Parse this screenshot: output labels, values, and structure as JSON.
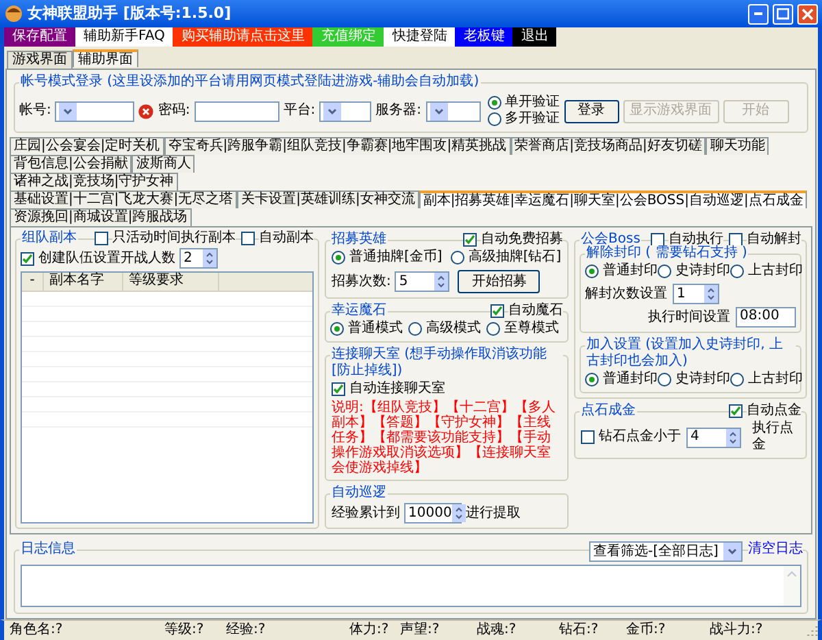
{
  "window": {
    "title": "女神联盟助手 [版本号:1.5.0]"
  },
  "toolbar": [
    {
      "label": "保存配置",
      "color": "#800080"
    },
    {
      "label": "辅助新手FAQ",
      "color": "#ffffff"
    },
    {
      "label": "购买辅助请点击这里",
      "color": "#ff3300"
    },
    {
      "label": "充值绑定",
      "color": "#33cc33"
    },
    {
      "label": "快捷登陆",
      "color": "#ffffff"
    },
    {
      "label": "老板键",
      "color": "#0000ff"
    },
    {
      "label": "退出",
      "color": "#000000"
    }
  ],
  "main_tabs": [
    {
      "label": "游戏界面",
      "selected": false
    },
    {
      "label": "辅助界面",
      "selected": true
    }
  ],
  "login": {
    "title": "帐号模式登录 (这里设添加的平台请用网页模式登陆进游戏-辅助会自动加载)",
    "account_label": "帐号:",
    "password_label": "密码:",
    "platform_label": "平台:",
    "server_label": "服务器:",
    "verify_options": [
      {
        "label": "单开验证",
        "selected": true
      },
      {
        "label": "多开验证",
        "selected": false
      }
    ],
    "buttons": [
      {
        "label": "登录",
        "disabled": false
      },
      {
        "label": "显示游戏界面",
        "disabled": true
      },
      {
        "label": "开始",
        "disabled": true
      }
    ]
  },
  "feature_tabs": [
    [
      {
        "label": "庄园|公会宴会|定时关机",
        "selected": false
      },
      {
        "label": "夺宝奇兵|跨服争霸|组队竞技|争霸赛|地牢围攻|精英挑战",
        "selected": false
      },
      {
        "label": "荣誉商店|竞技场商品|好友切磋",
        "selected": false
      },
      {
        "label": "聊天功能",
        "selected": false
      },
      {
        "label": "背包信息|公会捐献",
        "selected": false
      },
      {
        "label": "波斯商人",
        "selected": false
      }
    ],
    [
      {
        "label": "诸神之战|竞技场|守护女神",
        "selected": false
      }
    ],
    [
      {
        "label": "基础设置|十二宫|飞龙大赛|无尽之塔",
        "selected": false
      },
      {
        "label": "关卡设置|英雄训练|女神交流",
        "selected": false
      },
      {
        "label": "副本|招募英雄|幸运魔石|聊天室|公会BOSS|自动巡逻|点石成金",
        "selected": true
      },
      {
        "label": "资源挽回|商城设置|跨服战场",
        "selected": false
      }
    ]
  ],
  "dungeon": {
    "title": "组队副本",
    "options": [
      {
        "label": "只活动时间执行副本",
        "checked": false
      },
      {
        "label": "自动副本",
        "checked": false
      }
    ],
    "team": {
      "label": "创建队伍设置开战人数",
      "checked": true,
      "value": "2"
    },
    "columns": [
      "-",
      "副本名字",
      "等级要求"
    ]
  },
  "recruit": {
    "title": "招募英雄",
    "auto": {
      "label": "自动免费招募",
      "checked": true
    },
    "options": [
      {
        "label": "普通抽牌[金币]",
        "selected": true
      },
      {
        "label": "高级抽牌[钻石]",
        "selected": false
      }
    ],
    "count_label": "招募次数:",
    "count": "5",
    "button": "开始招募"
  },
  "lucky_stone": {
    "title": "幸运魔石",
    "auto": {
      "label": "自动魔石",
      "checked": true
    },
    "options": [
      {
        "label": "普通模式",
        "selected": true
      },
      {
        "label": "高级模式",
        "selected": false
      },
      {
        "label": "至尊模式",
        "selected": false
      }
    ]
  },
  "chat": {
    "title": "连接聊天室 (想手动操作取消该功能[防止掉线])",
    "auto": {
      "label": "自动连接聊天室",
      "checked": true
    },
    "note": "说明:【组队竞技】【十二宫】【多人副本】【答题】【守护女神】【主线任务】【都需要该功能支持】【手动操作游戏取消该选项】【连接聊天室会使游戏掉线】"
  },
  "patrol": {
    "title": "自动巡逻",
    "label": "经验累计到",
    "value": "10000",
    "suffix": "进行提取"
  },
  "guild_boss": {
    "title": "公会Boss",
    "options": [
      {
        "label": "自动执行",
        "checked": false
      },
      {
        "label": "自动解封",
        "checked": false
      }
    ],
    "unseal": {
      "title": "解除封印 ( 需要钻石支持 )",
      "options": [
        {
          "label": "普通封印",
          "selected": true
        },
        {
          "label": "史诗封印",
          "selected": false
        },
        {
          "label": "上古封印",
          "selected": false
        }
      ],
      "count_label": "解封次数设置",
      "count": "1",
      "time_label": "执行时间设置",
      "time": "08:00"
    },
    "join": {
      "title": "加入设置 (设置加入史诗封印, 上古封印也会加入)",
      "options": [
        {
          "label": "普通封印",
          "selected": true
        },
        {
          "label": "史诗封印",
          "selected": false
        },
        {
          "label": "上古封印",
          "selected": false
        }
      ]
    }
  },
  "gold": {
    "title": "点石成金",
    "auto": {
      "label": "自动点金",
      "checked": true
    },
    "option": {
      "label": "钻石点金小于",
      "checked": false
    },
    "value": "4",
    "suffix": "执行点金"
  },
  "log": {
    "title": "日志信息",
    "filter": "查看筛选-[全部日志]",
    "clear": "清空日志"
  },
  "status_bar": [
    "角色名:?",
    "等级:?",
    "经验:?",
    "体力:?",
    "声望:?",
    "战魂:?",
    "钻石:?",
    "金币:?",
    "战斗力:?"
  ]
}
